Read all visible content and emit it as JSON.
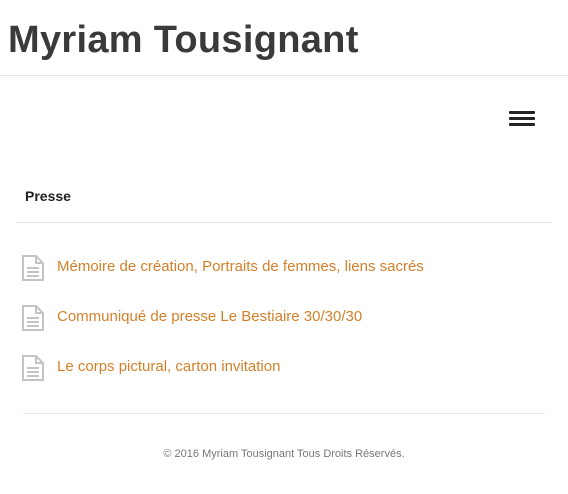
{
  "site": {
    "title": "Myriam Tousignant"
  },
  "nav": {
    "menu_icon": "hamburger-icon"
  },
  "section": {
    "title": "Presse"
  },
  "files": [
    {
      "icon": "document-icon",
      "label": "Mémoire de création, Portraits de femmes, liens sacrés"
    },
    {
      "icon": "document-icon",
      "label": "Communiqué de presse Le Bestiaire 30/30/30"
    },
    {
      "icon": "document-icon",
      "label": "Le corps pictural, carton invitation"
    }
  ],
  "footer": {
    "copyright": "© 2016 Myriam Tousignant Tous Droits Réservés."
  },
  "colors": {
    "link": "#d4802a",
    "icon": "#c4c4c4",
    "title": "#3a3a3a"
  }
}
